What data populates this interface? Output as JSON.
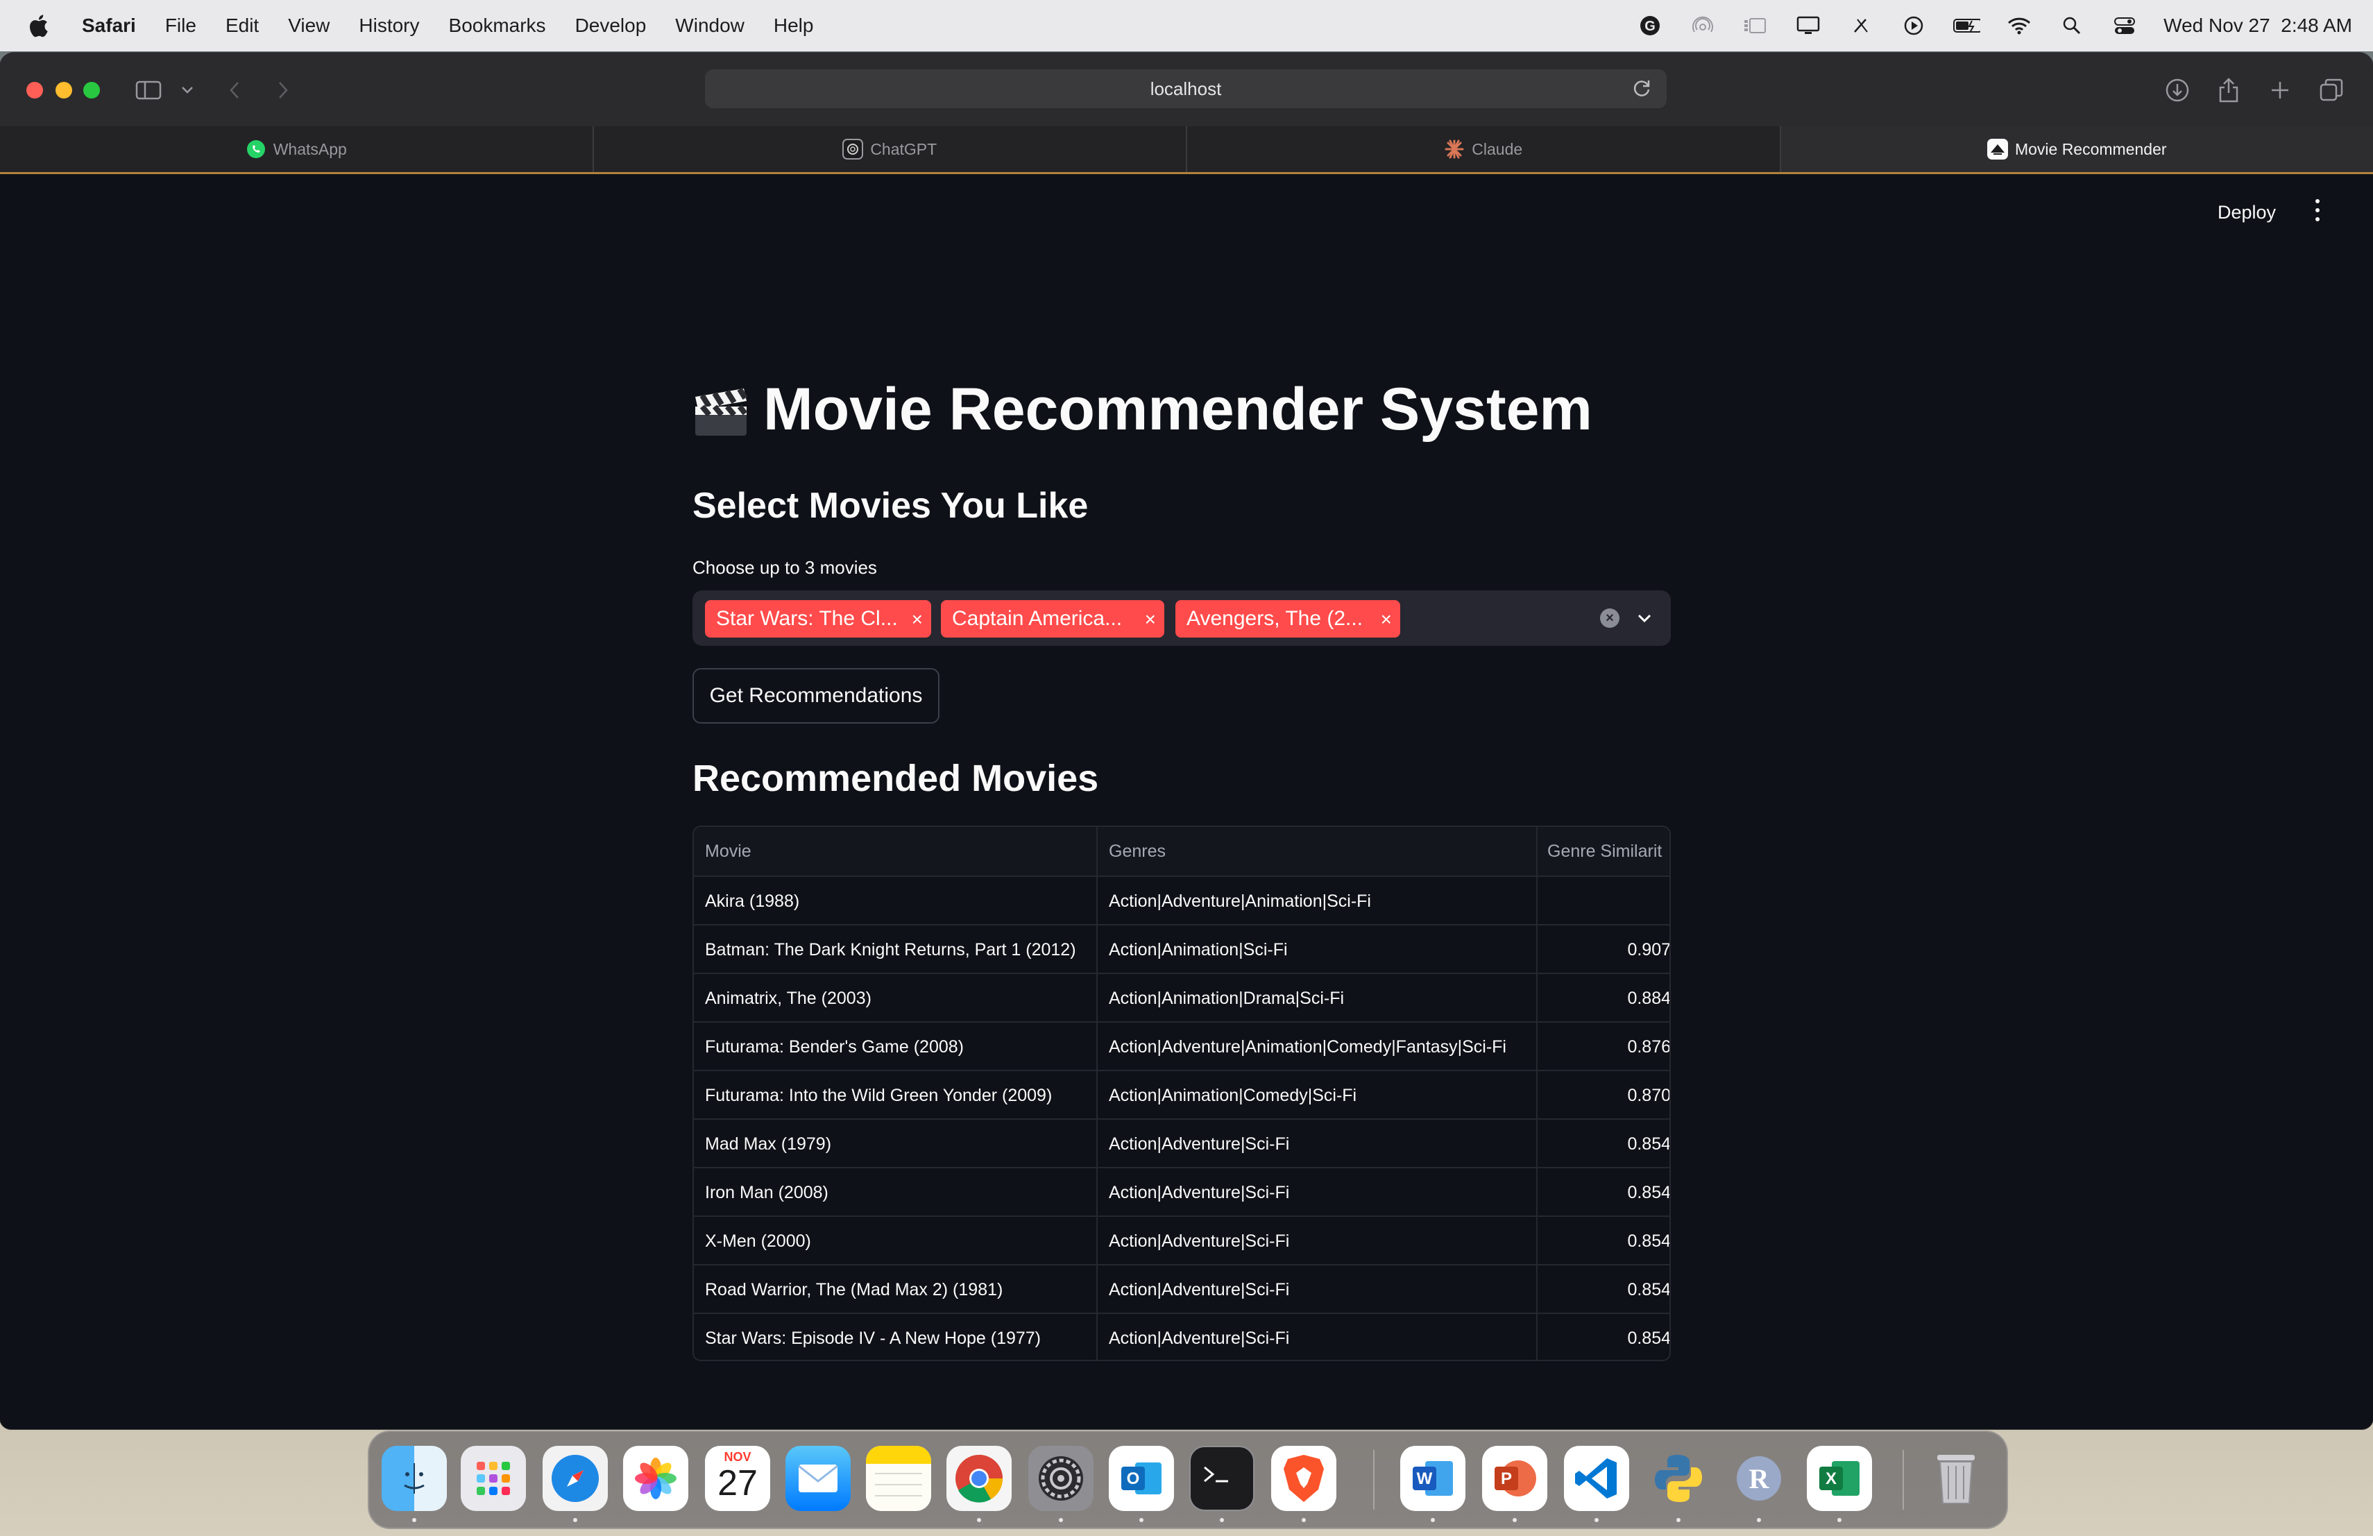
{
  "menubar": {
    "app_name": "Safari",
    "menus": [
      "File",
      "Edit",
      "View",
      "History",
      "Bookmarks",
      "Develop",
      "Window",
      "Help"
    ],
    "datetime": "Wed Nov 27  2:48 AM",
    "status_icons": [
      "grammarly-icon",
      "airdrop-icon",
      "stage-manager-icon",
      "display-icon",
      "pen-icon",
      "play-icon",
      "battery-icon",
      "wifi-icon",
      "search-icon",
      "control-center-icon"
    ]
  },
  "browser": {
    "url": "localhost",
    "tabs": [
      {
        "label": "WhatsApp",
        "icon": "whatsapp-icon",
        "active": false
      },
      {
        "label": "ChatGPT",
        "icon": "chatgpt-icon",
        "active": false
      },
      {
        "label": "Claude",
        "icon": "claude-icon",
        "active": false
      },
      {
        "label": "Movie Recommender",
        "icon": "streamlit-icon",
        "active": true
      }
    ]
  },
  "header": {
    "deploy_label": "Deploy"
  },
  "app": {
    "title_emoji": "🎬",
    "title": "Movie Recommender System",
    "subtitle": "Select Movies You Like",
    "select_label": "Choose up to 3 movies",
    "selected_movies": [
      "Star Wars: The Cl...",
      "Captain America...",
      "Avengers, The (2..."
    ],
    "chip_remove": "×",
    "button_label": "Get Recommendations",
    "results_title": "Recommended Movies"
  },
  "table": {
    "columns": [
      "Movie",
      "Genres",
      "Genre Similarit"
    ],
    "rows": [
      {
        "movie": "Akira (1988)",
        "genres": "Action|Adventure|Animation|Sci-Fi",
        "similarity": ""
      },
      {
        "movie": "Batman: The Dark Knight Returns, Part 1 (2012)",
        "genres": "Action|Animation|Sci-Fi",
        "similarity": "0.907"
      },
      {
        "movie": "Animatrix, The (2003)",
        "genres": "Action|Animation|Drama|Sci-Fi",
        "similarity": "0.884"
      },
      {
        "movie": "Futurama: Bender's Game (2008)",
        "genres": "Action|Adventure|Animation|Comedy|Fantasy|Sci-Fi",
        "similarity": "0.876"
      },
      {
        "movie": "Futurama: Into the Wild Green Yonder (2009)",
        "genres": "Action|Animation|Comedy|Sci-Fi",
        "similarity": "0.870"
      },
      {
        "movie": "Mad Max (1979)",
        "genres": "Action|Adventure|Sci-Fi",
        "similarity": "0.854"
      },
      {
        "movie": "Iron Man (2008)",
        "genres": "Action|Adventure|Sci-Fi",
        "similarity": "0.854"
      },
      {
        "movie": "X-Men (2000)",
        "genres": "Action|Adventure|Sci-Fi",
        "similarity": "0.854"
      },
      {
        "movie": "Road Warrior, The (Mad Max 2) (1981)",
        "genres": "Action|Adventure|Sci-Fi",
        "similarity": "0.854"
      },
      {
        "movie": "Star Wars: Episode IV - A New Hope (1977)",
        "genres": "Action|Adventure|Sci-Fi",
        "similarity": "0.854"
      }
    ]
  },
  "dock": {
    "calendar_month": "NOV",
    "calendar_day": "27",
    "apps": [
      "finder-icon",
      "launchpad-icon",
      "safari-icon",
      "photos-icon",
      "calendar-icon",
      "mail-icon",
      "notes-icon",
      "chrome-icon",
      "system-settings-icon",
      "outlook-icon",
      "terminal-icon",
      "brave-icon",
      "word-icon",
      "powerpoint-icon",
      "vscode-icon",
      "python-icon",
      "r-icon",
      "excel-icon",
      "trash-icon"
    ]
  },
  "colors": {
    "accent": "#ff4b4b",
    "page_bg": "#0e1117",
    "input_bg": "#262730"
  }
}
